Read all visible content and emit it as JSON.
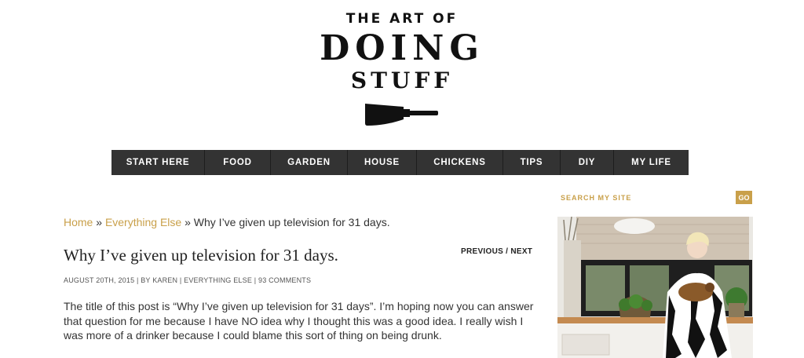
{
  "logo": {
    "line1": "THE ART OF",
    "line2": "DOING",
    "line3": "STUFF"
  },
  "nav": {
    "items": [
      {
        "label": "START HERE"
      },
      {
        "label": "FOOD"
      },
      {
        "label": "GARDEN"
      },
      {
        "label": "HOUSE"
      },
      {
        "label": "CHICKENS"
      },
      {
        "label": "TIPS"
      },
      {
        "label": "DIY"
      },
      {
        "label": "MY LIFE"
      }
    ]
  },
  "search": {
    "placeholder": "SEARCH MY SITE",
    "button_label": "GO"
  },
  "breadcrumb": {
    "home": "Home",
    "sep1": " » ",
    "category": "Everything Else",
    "sep2": " » ",
    "current": "Why I’ve given up television for 31 days."
  },
  "post": {
    "title": "Why I’ve given up television for 31 days.",
    "previous": "PREVIOUS",
    "divider": " / ",
    "next": "NEXT",
    "date": "AUGUST 20TH, 2015",
    "sep": " | ",
    "by": "BY ",
    "author": "KAREN",
    "category": "EVERYTHING ELSE",
    "comments": "93 COMMENTS",
    "body": "The title of this post is “Why I’ve given up television for 31 days”. I’m hoping now you can answer that question for me because I have NO idea why I thought this was a good idea. I really wish I was more of a drinker because I could blame this sort of thing on being drunk."
  },
  "colors": {
    "accent": "#c9a04a",
    "nav_bg": "#333333",
    "text": "#222222"
  }
}
